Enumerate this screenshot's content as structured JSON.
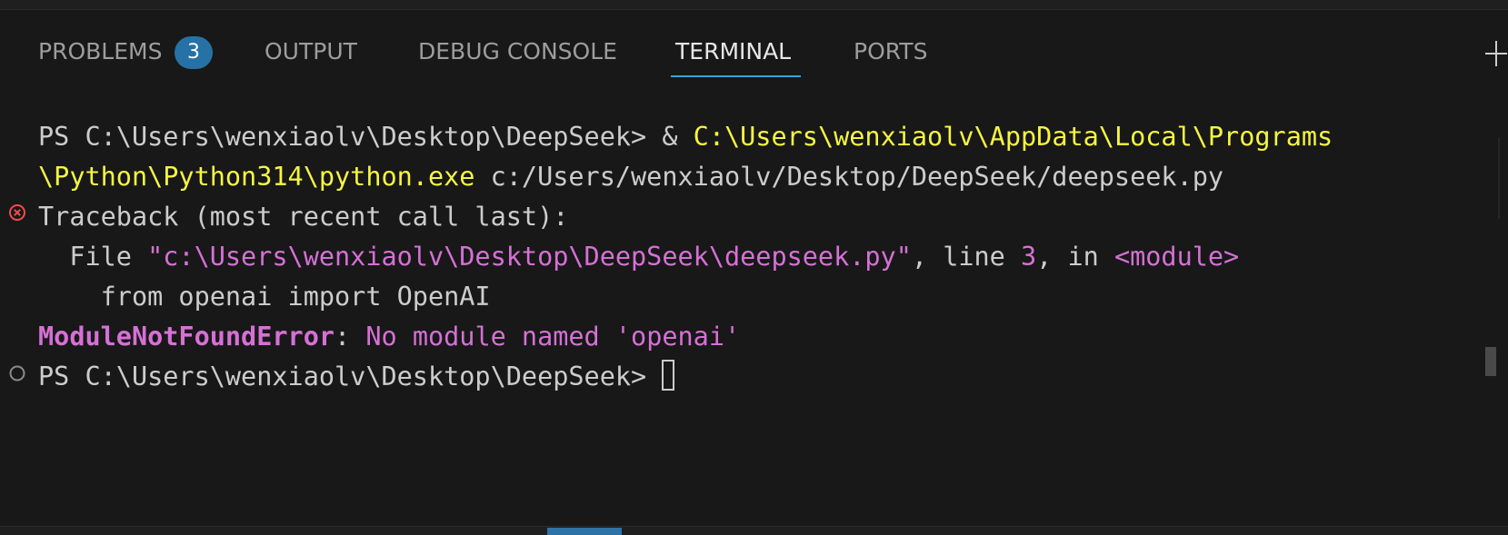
{
  "tabs": [
    {
      "label": "PROBLEMS",
      "badge": "3",
      "active": false
    },
    {
      "label": "OUTPUT",
      "active": false
    },
    {
      "label": "DEBUG CONSOLE",
      "active": false
    },
    {
      "label": "TERMINAL",
      "active": true
    },
    {
      "label": "PORTS",
      "active": false
    }
  ],
  "terminal": {
    "cmd_prompt": "PS C:\\Users\\wenxiaolv\\Desktop\\DeepSeek> ",
    "cmd_amp": "& ",
    "cmd_exe_part1": "C:\\Users\\wenxiaolv\\AppData\\Local\\Programs",
    "cmd_exe_part2": "\\Python\\Python314\\python.exe",
    "cmd_arg": " c:/Users/wenxiaolv/Desktop/DeepSeek/deepseek.py",
    "traceback": "Traceback (most recent call last):",
    "file_prefix": "  File ",
    "file_path": "\"c:\\Users\\wenxiaolv\\Desktop\\DeepSeek\\deepseek.py\"",
    "file_line_label": ", line ",
    "file_line_num": "3",
    "file_in": ", in ",
    "file_module": "<module>",
    "code_line": "    from openai import OpenAI",
    "error_name": "ModuleNotFoundError",
    "error_sep": ": ",
    "error_msg": "No module named 'openai'",
    "final_prompt": "PS C:\\Users\\wenxiaolv\\Desktop\\DeepSeek> "
  },
  "icons": {
    "error": "error-circle-icon",
    "prompt": "command-circle-icon",
    "new_terminal": "plus-icon"
  },
  "colors": {
    "background": "#181818",
    "text": "#cccccc",
    "yellow": "#f5f543",
    "magenta": "#d670d6",
    "error_icon": "#f14c4c",
    "badge": "#2672a7",
    "tab_active_underline": "#3b9fde"
  }
}
